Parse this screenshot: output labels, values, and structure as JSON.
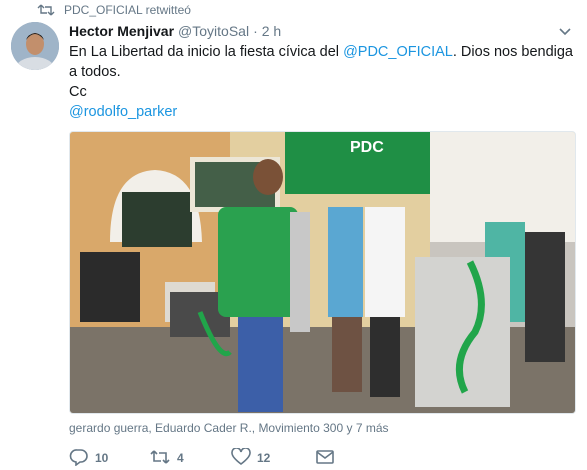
{
  "retweet_context": {
    "text": "PDC_OFICIAL retwitteó",
    "icon": "retweet-icon"
  },
  "author": {
    "name": "Hector Menjivar",
    "handle": "@ToyitoSal",
    "dot": "·",
    "time": "2 h"
  },
  "tweet": {
    "text_before": "En La Libertad da inicio la fiesta cívica del ",
    "mention_main": "@PDC_OFICIAL",
    "text_after": ". Dios nos bendiga a todos.",
    "line_cc": "Cc",
    "mention_cc": "@rodolfo_parker"
  },
  "media": {
    "flag_text": "PDC",
    "colors": {
      "flag": "#1f8f45",
      "shirt": "#2aa14f",
      "wall": "#e9d3a0",
      "floor": "#7b7368"
    }
  },
  "tagged_line": "gerardo guerra, Eduardo Cader R., Movimiento 300 y 7 más",
  "actions": {
    "reply": {
      "icon": "reply-icon",
      "count": "10"
    },
    "retweet": {
      "icon": "retweet-icon",
      "count": "4"
    },
    "like": {
      "icon": "heart-icon",
      "count": "12"
    },
    "dm": {
      "icon": "envelope-icon"
    }
  },
  "colors": {
    "link": "#1b95e0",
    "muted": "#657786",
    "text": "#14171a"
  }
}
